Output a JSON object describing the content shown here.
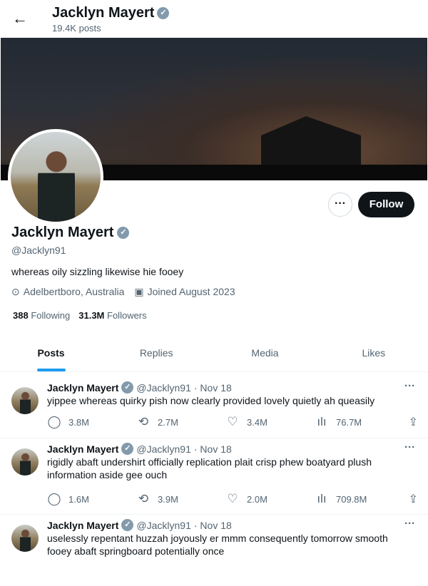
{
  "header": {
    "back_icon": "arrow-left-icon",
    "title": "Jacklyn Mayert",
    "posts_count": "19.4K posts"
  },
  "profile": {
    "name": "Jacklyn Mayert",
    "handle": "@Jacklyn91",
    "bio": "whereas oily sizzling likewise hie fooey",
    "location": "Adelbertboro, Australia",
    "joined": "Joined August 2023",
    "following_count": "388",
    "following_label": "Following",
    "followers_count": "31.3M",
    "followers_label": "Followers",
    "more_label": "···",
    "follow_label": "Follow",
    "verified_mark": "✓"
  },
  "tabs": [
    {
      "label": "Posts"
    },
    {
      "label": "Replies"
    },
    {
      "label": "Media"
    },
    {
      "label": "Likes"
    }
  ],
  "tweets": [
    {
      "name": "Jacklyn Mayert",
      "handle": "@Jacklyn91",
      "date": "· Nov 18",
      "text": "yippee whereas quirky pish now clearly provided lovely quietly ah queasily",
      "replies": "3.8M",
      "reposts": "2.7M",
      "likes": "3.4M",
      "views": "76.7M"
    },
    {
      "name": "Jacklyn Mayert",
      "handle": "@Jacklyn91",
      "date": "· Nov 18",
      "text": "rigidly abaft undershirt officially replication plait crisp phew boatyard plush information aside gee ouch",
      "replies": "1.6M",
      "reposts": "3.9M",
      "likes": "2.0M",
      "views": "709.8M"
    },
    {
      "name": "Jacklyn Mayert",
      "handle": "@Jacklyn91",
      "date": "· Nov 18",
      "text": "uselessly repentant huzzah joyously er mmm consequently tomorrow smooth fooey abaft springboard potentially once"
    }
  ],
  "colors": {
    "accent": "#1d9bf0",
    "text": "#0f1419",
    "muted": "#536471"
  }
}
